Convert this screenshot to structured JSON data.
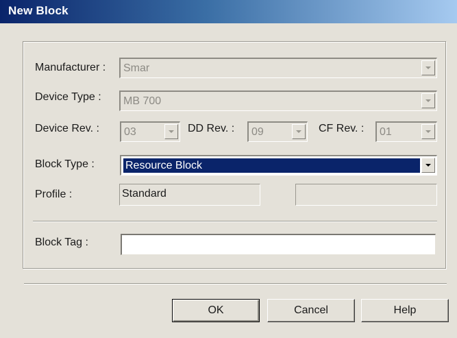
{
  "window": {
    "title": "New Block"
  },
  "form": {
    "manufacturer": {
      "label": "Manufacturer :",
      "value": "Smar"
    },
    "device_type": {
      "label": "Device Type :",
      "value": "MB 700"
    },
    "device_rev": {
      "label": "Device Rev. :",
      "value": "03"
    },
    "dd_rev": {
      "label": "DD Rev. :",
      "value": "09"
    },
    "cf_rev": {
      "label": "CF Rev. :",
      "value": "01"
    },
    "block_type": {
      "label": "Block Type :",
      "value": "Resource Block"
    },
    "profile": {
      "label": "Profile :",
      "value": "Standard",
      "value2": ""
    },
    "block_tag": {
      "label": "Block Tag :",
      "value": ""
    }
  },
  "buttons": {
    "ok": "OK",
    "cancel": "Cancel",
    "help": "Help"
  },
  "colors": {
    "title_bar_start": "#0a246a",
    "selection": "#0a246a",
    "dialog_bg": "#e4e1d9"
  }
}
